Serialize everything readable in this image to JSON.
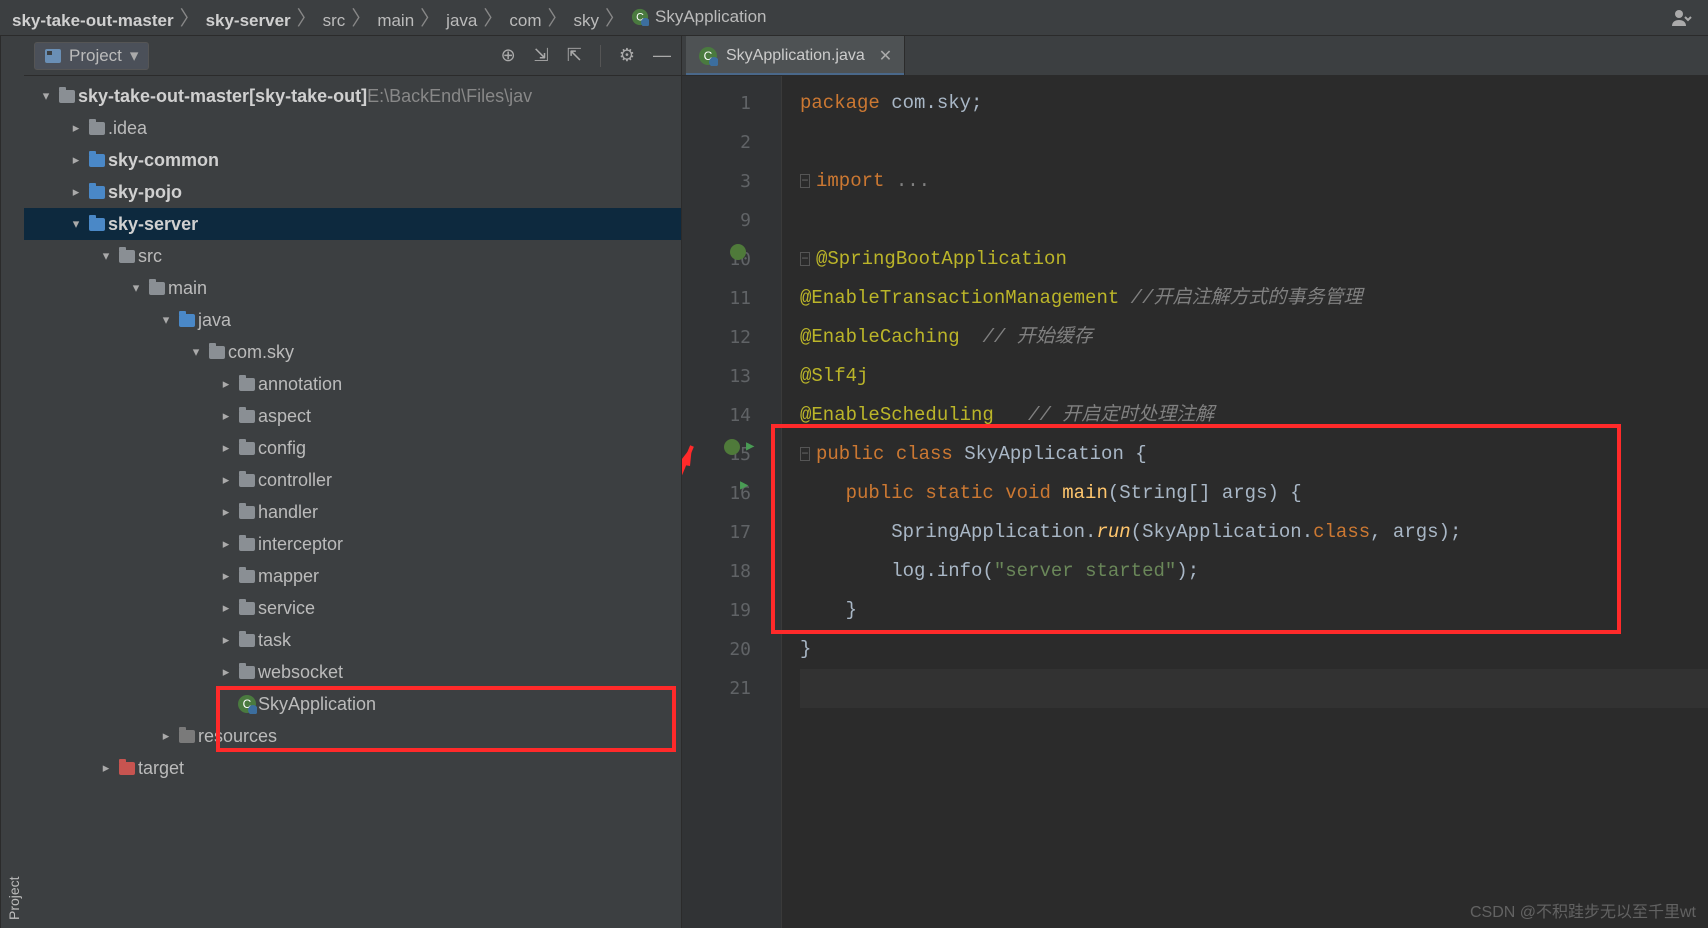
{
  "breadcrumbs": {
    "items": [
      {
        "label": "sky-take-out-master",
        "bold": true
      },
      {
        "label": "sky-server",
        "bold": true
      },
      {
        "label": "src"
      },
      {
        "label": "main"
      },
      {
        "label": "java"
      },
      {
        "label": "com"
      },
      {
        "label": "sky"
      },
      {
        "label": "SkyApplication",
        "icon": "class"
      }
    ]
  },
  "left_rail": {
    "label": "Project"
  },
  "project_panel": {
    "title": "Project",
    "tree": [
      {
        "indent": 0,
        "arrow": "v",
        "icon": "folder",
        "label": "sky-take-out-master",
        "bold": true,
        "suffix": " [sky-take-out]",
        "path": "  E:\\BackEnd\\Files\\jav"
      },
      {
        "indent": 1,
        "arrow": ">",
        "icon": "folder",
        "label": ".idea",
        "bold": false
      },
      {
        "indent": 1,
        "arrow": ">",
        "icon": "folder-blue",
        "label": "sky-common",
        "bold": true
      },
      {
        "indent": 1,
        "arrow": ">",
        "icon": "folder-blue",
        "label": "sky-pojo",
        "bold": true
      },
      {
        "indent": 1,
        "arrow": "v",
        "icon": "folder-blue",
        "label": "sky-server",
        "bold": true,
        "selected": true
      },
      {
        "indent": 2,
        "arrow": "v",
        "icon": "folder",
        "label": "src"
      },
      {
        "indent": 3,
        "arrow": "v",
        "icon": "folder",
        "label": "main"
      },
      {
        "indent": 4,
        "arrow": "v",
        "icon": "folder-blue",
        "label": "java"
      },
      {
        "indent": 5,
        "arrow": "v",
        "icon": "folder-pkg",
        "label": "com.sky"
      },
      {
        "indent": 6,
        "arrow": ">",
        "icon": "folder-pkg",
        "label": "annotation"
      },
      {
        "indent": 6,
        "arrow": ">",
        "icon": "folder-pkg",
        "label": "aspect"
      },
      {
        "indent": 6,
        "arrow": ">",
        "icon": "folder-pkg",
        "label": "config"
      },
      {
        "indent": 6,
        "arrow": ">",
        "icon": "folder-pkg",
        "label": "controller"
      },
      {
        "indent": 6,
        "arrow": ">",
        "icon": "folder-pkg",
        "label": "handler"
      },
      {
        "indent": 6,
        "arrow": ">",
        "icon": "folder-pkg",
        "label": "interceptor"
      },
      {
        "indent": 6,
        "arrow": ">",
        "icon": "folder-pkg",
        "label": "mapper"
      },
      {
        "indent": 6,
        "arrow": ">",
        "icon": "folder-pkg",
        "label": "service"
      },
      {
        "indent": 6,
        "arrow": ">",
        "icon": "folder-pkg",
        "label": "task"
      },
      {
        "indent": 6,
        "arrow": ">",
        "icon": "folder-pkg",
        "label": "websocket"
      },
      {
        "indent": 6,
        "arrow": " ",
        "icon": "class",
        "label": "SkyApplication"
      },
      {
        "indent": 4,
        "arrow": ">",
        "icon": "folder-resources",
        "label": "resources"
      },
      {
        "indent": 2,
        "arrow": ">",
        "icon": "folder-red",
        "label": "target"
      }
    ]
  },
  "editor": {
    "tab": {
      "filename": "SkyApplication.java"
    },
    "line_numbers": [
      "1",
      "2",
      "3",
      "9",
      "10",
      "11",
      "12",
      "13",
      "14",
      "15",
      "16",
      "17",
      "18",
      "19",
      "20",
      "21"
    ],
    "code_lines": [
      {
        "tokens": [
          {
            "t": "package ",
            "c": "kw"
          },
          {
            "t": "com.sky",
            "c": "id"
          },
          {
            "t": ";",
            "c": "id"
          }
        ]
      },
      {
        "tokens": []
      },
      {
        "tokens": [
          {
            "t": "import ",
            "c": "kw"
          },
          {
            "t": "...",
            "c": "fold"
          }
        ],
        "foldable": true
      },
      {
        "tokens": []
      },
      {
        "tokens": [
          {
            "t": "@SpringBootApplication",
            "c": "ann"
          }
        ],
        "foldable": true
      },
      {
        "tokens": [
          {
            "t": "@EnableTransactionManagement",
            "c": "ann"
          },
          {
            "t": " //开启注解方式的事务管理",
            "c": "cmt"
          }
        ]
      },
      {
        "tokens": [
          {
            "t": "@EnableCaching",
            "c": "ann"
          },
          {
            "t": "  // 开始缓存",
            "c": "cmt"
          }
        ]
      },
      {
        "tokens": [
          {
            "t": "@Slf4j",
            "c": "ann"
          }
        ]
      },
      {
        "tokens": [
          {
            "t": "@EnableScheduling",
            "c": "ann"
          },
          {
            "t": "   // 开启定时处理注解",
            "c": "cmt"
          }
        ]
      },
      {
        "tokens": [
          {
            "t": "public class ",
            "c": "kw"
          },
          {
            "t": "SkyApplication ",
            "c": "id"
          },
          {
            "t": "{",
            "c": "id"
          }
        ],
        "foldable": true
      },
      {
        "tokens": [
          {
            "t": "    ",
            "c": "id"
          },
          {
            "t": "public static void ",
            "c": "kw"
          },
          {
            "t": "main",
            "c": "fn"
          },
          {
            "t": "(String[] args) {",
            "c": "id"
          }
        ]
      },
      {
        "tokens": [
          {
            "t": "        SpringApplication.",
            "c": "id"
          },
          {
            "t": "run",
            "c": "fnit"
          },
          {
            "t": "(SkyApplication.",
            "c": "id"
          },
          {
            "t": "class",
            "c": "kw"
          },
          {
            "t": ", args);",
            "c": "id"
          }
        ]
      },
      {
        "tokens": [
          {
            "t": "        ",
            "c": "id"
          },
          {
            "t": "log",
            "c": "id"
          },
          {
            "t": ".info(",
            "c": "id"
          },
          {
            "t": "\"server started\"",
            "c": "str"
          },
          {
            "t": ");",
            "c": "id"
          }
        ]
      },
      {
        "tokens": [
          {
            "t": "    }",
            "c": "id"
          }
        ]
      },
      {
        "tokens": [
          {
            "t": "}",
            "c": "id"
          }
        ]
      },
      {
        "tokens": [],
        "current": true
      }
    ]
  },
  "watermark": "CSDN @不积跬步无以至千里wt"
}
